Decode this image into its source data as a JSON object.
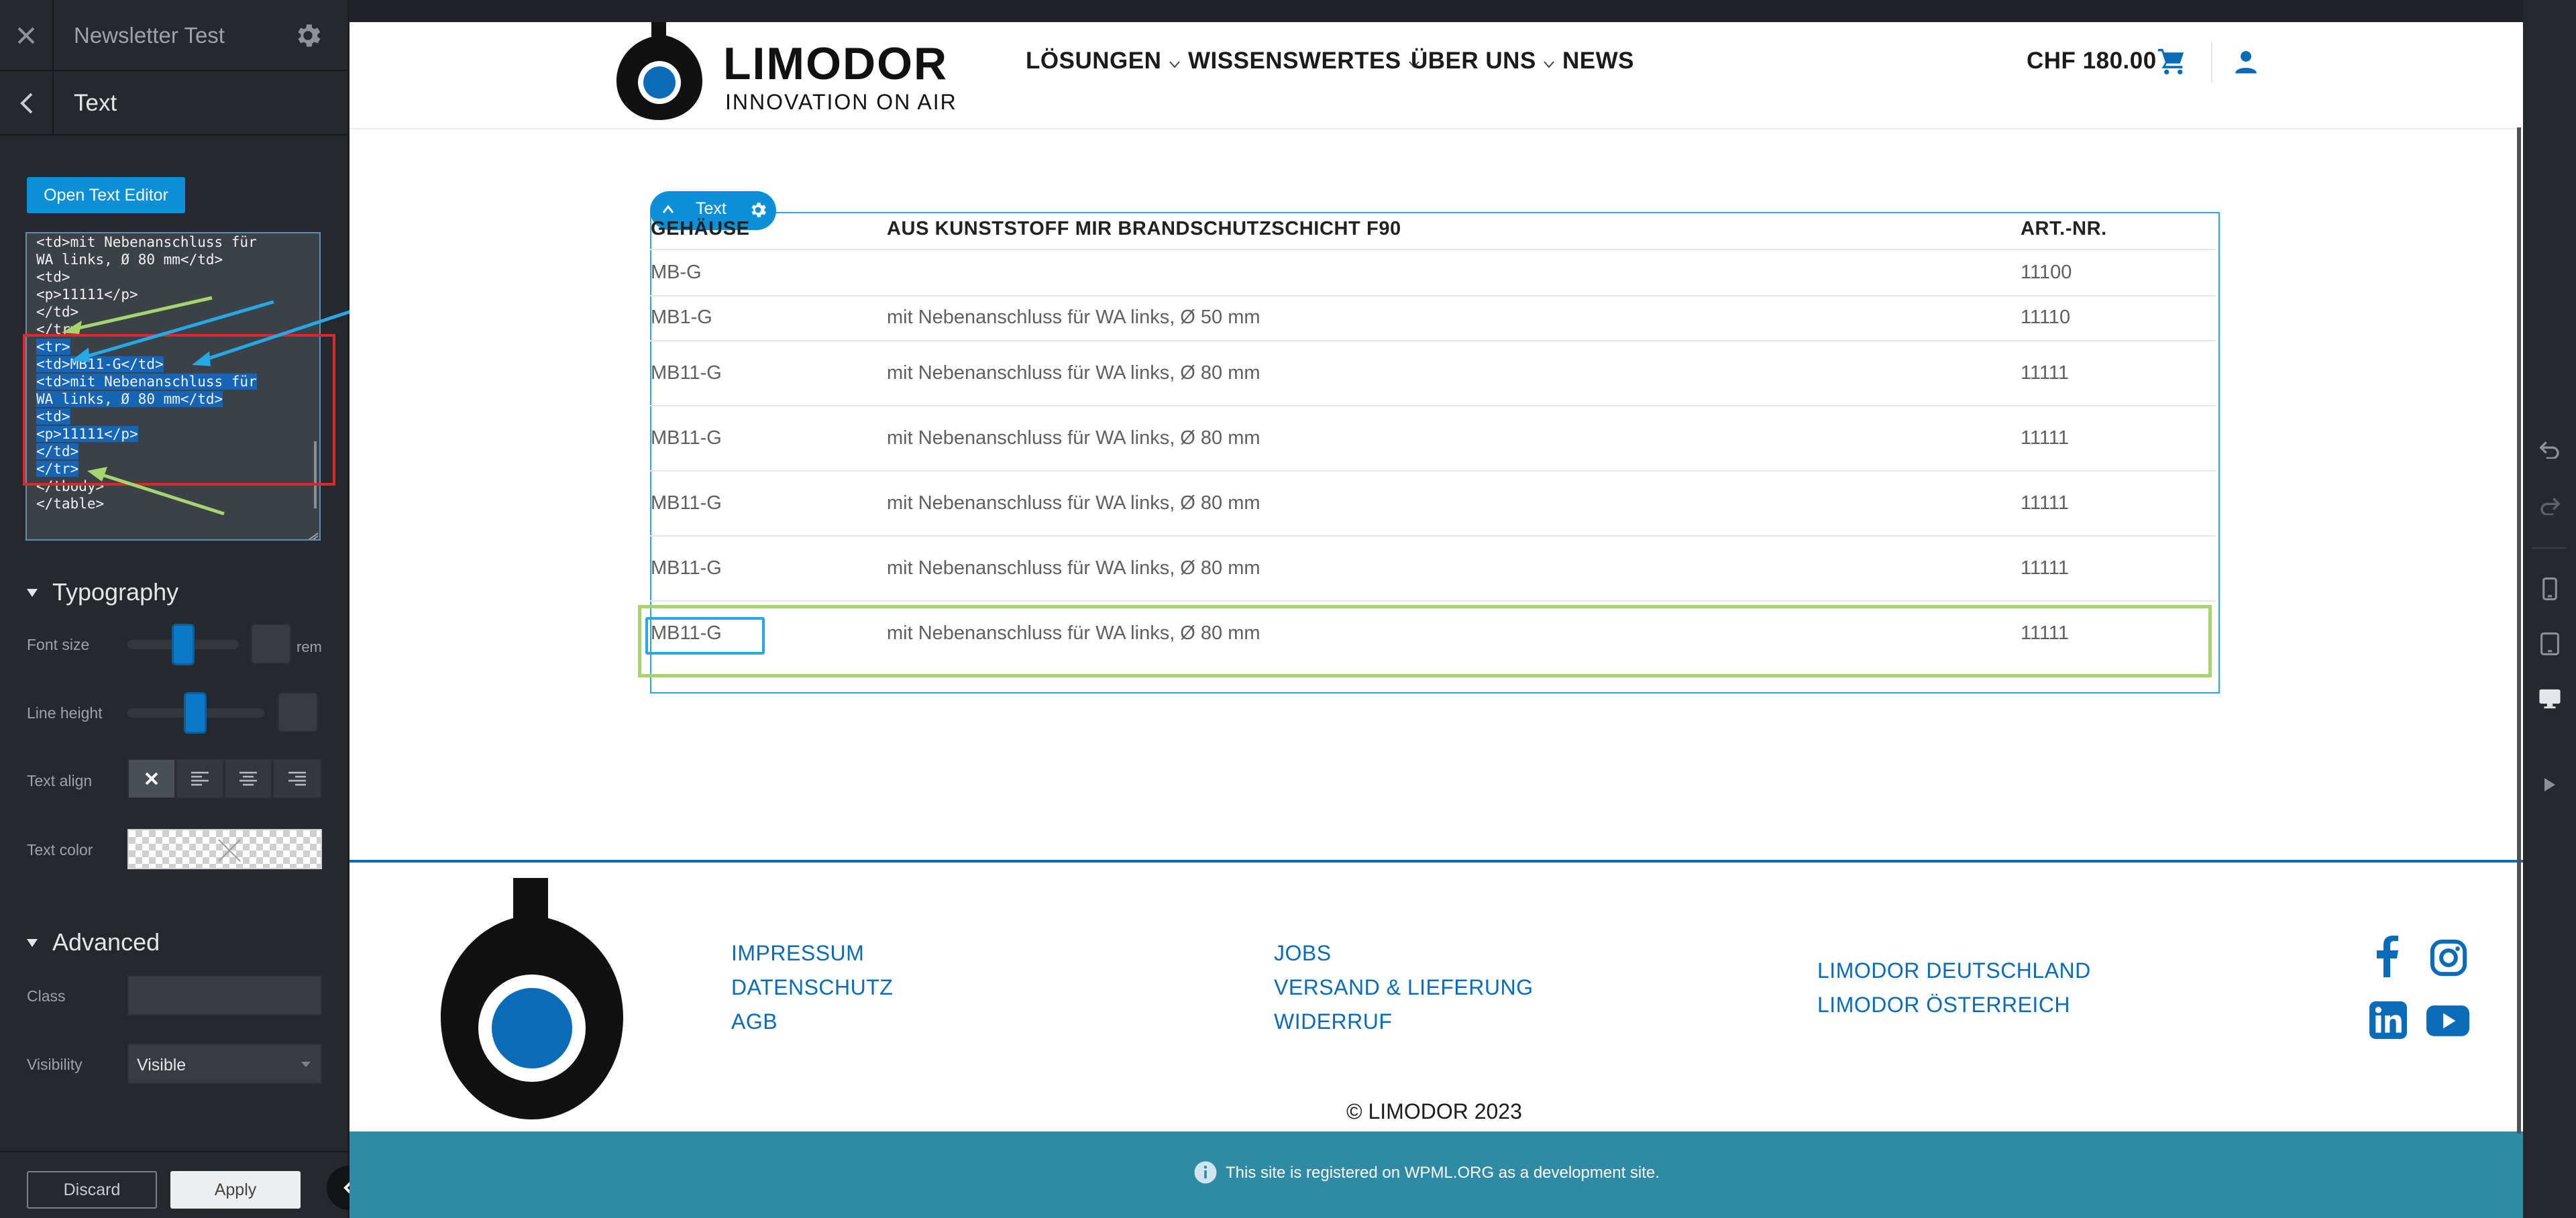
{
  "panel": {
    "title": "Newsletter Test",
    "section_title": "Text",
    "open_editor_label": "Open Text Editor",
    "code_lines": [
      "<td>mit Nebenanschluss für",
      "WA links, Ø 80 mm</td>",
      "<td>",
      "<p>11111</p>",
      "</td>",
      "</tr>",
      "<tr>",
      "<td>MB11-G</td>",
      "<td>mit Nebenanschluss für",
      "WA links, Ø 80 mm</td>",
      "<td>",
      "<p>11111</p>",
      "</td>",
      "</tr>",
      "</tbody>",
      "</table>"
    ],
    "typography": {
      "heading": "Typography",
      "font_size_label": "Font size",
      "font_size_unit": "rem",
      "line_height_label": "Line height",
      "text_align_label": "Text align",
      "text_color_label": "Text color"
    },
    "advanced": {
      "heading": "Advanced",
      "class_label": "Class",
      "visibility_label": "Visibility",
      "visibility_value": "Visible"
    },
    "discard_label": "Discard",
    "apply_label": "Apply"
  },
  "site": {
    "brand": "LIMODOR",
    "tagline": "INNOVATION ON AIR",
    "nav": [
      "LÖSUNGEN",
      "WISSENSWERTES",
      "ÜBER UNS",
      "NEWS"
    ],
    "cart_total": "CHF 180.00",
    "text_toolbar_label": "Text",
    "table": {
      "headers": [
        "GEHÄUSE",
        "AUS KUNSTSTOFF MIR BRANDSCHUTZSCHICHT F90",
        "ART.-NR."
      ],
      "rows": [
        {
          "model": "MB-G",
          "desc": "",
          "art": "11100"
        },
        {
          "model": "MB1-G",
          "desc": "mit Nebenanschluss für WA links, Ø 50 mm",
          "art": "11110"
        },
        {
          "model": "MB11-G",
          "desc": "mit Nebenanschluss für WA links, Ø 80 mm",
          "art": "11111"
        },
        {
          "model": "MB11-G",
          "desc": "mit Nebenanschluss für WA links, Ø 80 mm",
          "art": "11111"
        },
        {
          "model": "MB11-G",
          "desc": "mit Nebenanschluss für WA links, Ø 80 mm",
          "art": "11111"
        },
        {
          "model": "MB11-G",
          "desc": "mit Nebenanschluss für WA links, Ø 80 mm",
          "art": "11111"
        },
        {
          "model": "MB11-G",
          "desc": "mit Nebenanschluss für WA links, Ø 80 mm",
          "art": "11111"
        }
      ]
    },
    "footer": {
      "col1": [
        "IMPRESSUM",
        "DATENSCHUTZ",
        "AGB"
      ],
      "col2": [
        "JOBS",
        "VERSAND & LIEFERUNG",
        "WIDERRUF"
      ],
      "col3": [
        "LIMODOR DEUTSCHLAND",
        "LIMODOR ÖSTERREICH"
      ],
      "copyright": "© LIMODOR 2023",
      "notice": "This site is registered on WPML.ORG as a development site."
    }
  },
  "colors": {
    "accent_blue": "#0a6cb8",
    "button_blue": "#0b8fd6",
    "selection_outline": "#a6d56e",
    "annotation_red": "#e0262c",
    "annotation_cyan": "#25a8e6",
    "annotation_green": "#a6d56e",
    "notice_bar": "#2f8aa6"
  }
}
